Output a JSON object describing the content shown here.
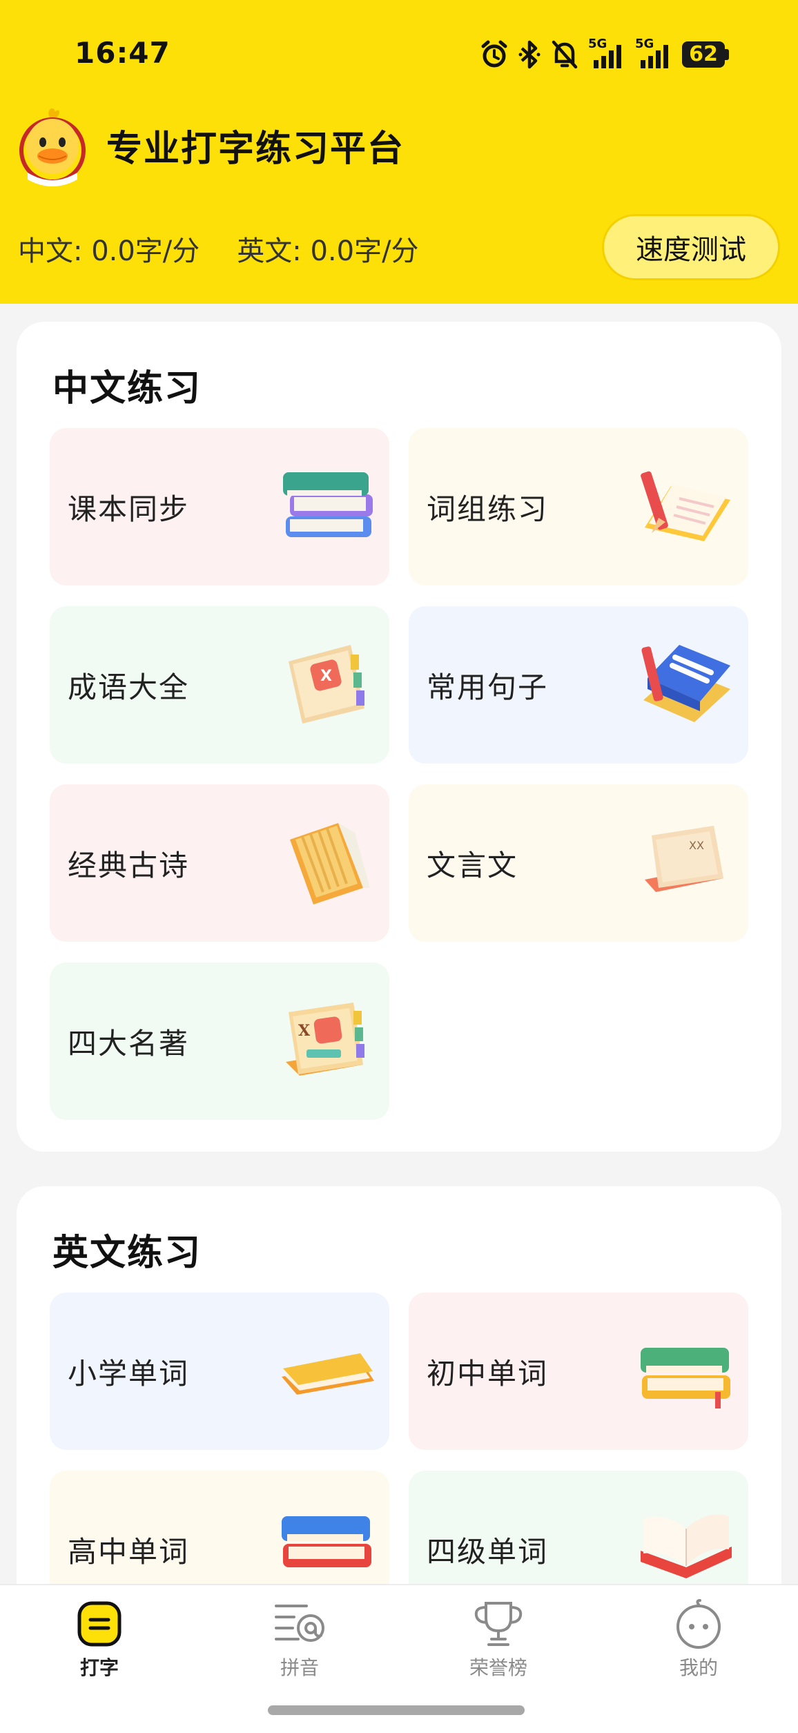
{
  "status_bar": {
    "time": "16:47",
    "network_1": "5G",
    "network_2": "5G",
    "battery": "62",
    "icons": [
      "alarm-icon",
      "bluetooth-icon",
      "bell-off-icon",
      "signal-5g-icon",
      "signal-5g-icon",
      "battery-icon"
    ]
  },
  "header": {
    "title": "专业打字练习平台",
    "logo": "duck-mascot-logo",
    "chinese_speed": "中文: 0.0字/分",
    "english_speed": "英文: 0.0字/分",
    "speed_test_button": "速度测试",
    "background_color": "#fde007"
  },
  "chinese_section": {
    "title": "中文练习",
    "items": [
      {
        "label": "课本同步",
        "icon": "stacked-books-icon"
      },
      {
        "label": "词组练习",
        "icon": "notebook-pencil-icon"
      },
      {
        "label": "成语大全",
        "icon": "scroll-book-icon"
      },
      {
        "label": "常用句子",
        "icon": "blue-notebook-icon"
      },
      {
        "label": "经典古诗",
        "icon": "bamboo-book-icon"
      },
      {
        "label": "文言文",
        "icon": "ancient-book-icon"
      },
      {
        "label": "四大名著",
        "icon": "classic-novel-icon"
      }
    ]
  },
  "english_section": {
    "title": "英文练习",
    "items": [
      {
        "label": "小学单词",
        "icon": "yellow-book-icon"
      },
      {
        "label": "初中单词",
        "icon": "green-yellow-books-icon"
      },
      {
        "label": "高中单词",
        "icon": "blue-red-books-icon"
      },
      {
        "label": "四级单词",
        "icon": "open-book-icon"
      }
    ]
  },
  "tabbar": {
    "tabs": [
      {
        "label": "打字",
        "icon": "typing-icon",
        "active": true
      },
      {
        "label": "拼音",
        "icon": "pinyin-icon",
        "active": false
      },
      {
        "label": "荣誉榜",
        "icon": "trophy-icon",
        "active": false
      },
      {
        "label": "我的",
        "icon": "profile-face-icon",
        "active": false
      }
    ]
  }
}
